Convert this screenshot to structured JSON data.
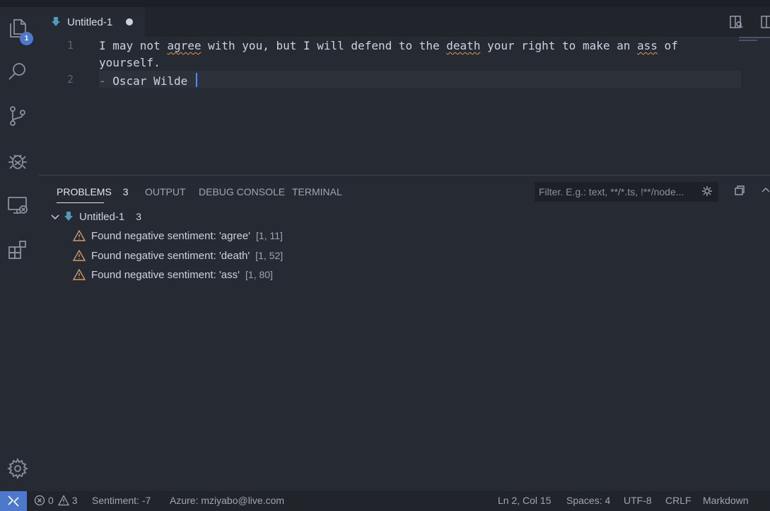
{
  "activity_bar": {
    "explorer_badge": "1",
    "items": [
      "files-icon",
      "search-icon",
      "source-control-icon",
      "debug-icon",
      "remote-explorer-icon",
      "extensions-icon"
    ],
    "settings": "gear-icon"
  },
  "tabs": [
    {
      "label": "Untitled-1",
      "dirty": true
    }
  ],
  "editor": {
    "line_numbers": [
      "1",
      "2"
    ],
    "line1_parts": {
      "a": "I may not ",
      "w1": "agree",
      "b": " with you, but I will defend to the ",
      "w2": "death",
      "c": " your right to make an ",
      "w3": "ass",
      "d": " of"
    },
    "line1_wrap": "yourself.",
    "line2_dash": "-",
    "line2_text": " Oscar Wilde "
  },
  "panel": {
    "tabs": {
      "problems": "PROBLEMS",
      "problems_count": "3",
      "output": "OUTPUT",
      "debug_console": "DEBUG CONSOLE",
      "terminal": "TERMINAL"
    },
    "filter_placeholder": "Filter. E.g.: text, **/*.ts, !**/node...",
    "file": {
      "name": "Untitled-1",
      "count": "3"
    },
    "problems": [
      {
        "message": "Found negative sentiment: 'agree'",
        "location": "[1, 11]"
      },
      {
        "message": "Found negative sentiment: 'death'",
        "location": "[1, 52]"
      },
      {
        "message": "Found negative sentiment: 'ass'",
        "location": "[1, 80]"
      }
    ]
  },
  "status_bar": {
    "errors": "0",
    "warnings": "3",
    "sentiment": "Sentiment: -7",
    "azure": "Azure: mziyabo@live.com",
    "position": "Ln 2, Col 15",
    "spaces": "Spaces: 4",
    "encoding": "UTF-8",
    "eol": "CRLF",
    "language": "Markdown"
  },
  "colors": {
    "accent": "#4d78cc",
    "warning": "#d19a66",
    "background": "#262a33"
  }
}
